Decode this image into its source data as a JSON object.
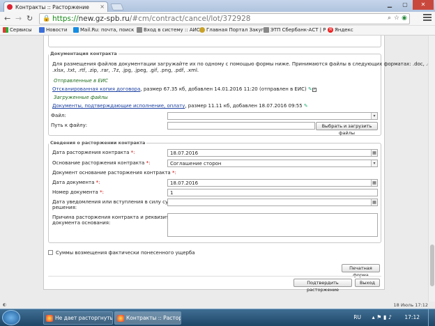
{
  "browser": {
    "tab_title": "Контракты :: Расторжение",
    "url_scheme": "https://",
    "url_host": "new.gz-spb.ru",
    "url_path": "/#cm/contract/cancel/lot/372928",
    "bookmarks": [
      "Сервисы",
      "Новости",
      "Mail.Ru: почта, поиск",
      "Вход в систему :: АИС",
      "Главная Портал Закуп",
      "ЭТП Сбербанк-АСТ | Р",
      "Яндекс"
    ]
  },
  "doc_section": {
    "legend": "Документация контракта",
    "info_line1": "Для размещения файлов документации загружайте их по одному с помощью формы ниже. Принимаются файлы в следующих форматах: .doc, .docx, .xls,",
    "info_line2": ".xlsx, .txt, .rtf, .zip, .rar, .7z, .jpg, .jpeg, .gif, .png, .pdf, .xml.",
    "sent_heading": "Отправленные в ЕИС",
    "sent_file_link": "Отсканированная копия договора",
    "sent_file_meta": ", размер 67.35 кб, добавлен 14.01.2016 11:20 (отправлен в ЕИС)",
    "uploaded_heading": "Загруженные файлы",
    "uploaded_file_link": "Документы, подтверждающие исполнение, оплату",
    "uploaded_file_meta": ", размер 11.11 кб, добавлен 18.07.2016 09:55",
    "file_label": "Файл:",
    "path_label": "Путь к файлу:",
    "upload_button": "Выбрать и загрузить файлы"
  },
  "cancel_section": {
    "legend": "Сведения о расторжении контракта",
    "date_label": "Дата расторжения контракта ",
    "date_value": "18.07.2016",
    "basis_label": "Основание расторжения контракта ",
    "basis_value": "Соглашение сторон",
    "basis_doc_label": "Документ основание расторжения контракта ",
    "doc_date_label": "Дата документа ",
    "doc_date_value": "18.07.2016",
    "doc_number_label": "Номер документа ",
    "doc_number_value": "1",
    "notify_label_line1": "Дата уведомления или вступления в силу судебного",
    "notify_label_line2": "решения:",
    "notify_value": "",
    "reason_label_line1": "Причина расторжения контракта и реквизиты",
    "reason_label_line2": "документа основания:",
    "required_mark": "*:"
  },
  "damages_checkbox_label": "Суммы возмещения фактически понесенного ущерба",
  "print_button": "Печатная форма",
  "confirm_button": "Подтвердить расторжение",
  "exit_button": "Выход",
  "statusbar_text": "18 Июль 17:12",
  "taskbar": {
    "item1": "Не дает расторгнуть...",
    "item2": "Контракты :: Растор...",
    "lang": "RU",
    "time": "17:12"
  }
}
